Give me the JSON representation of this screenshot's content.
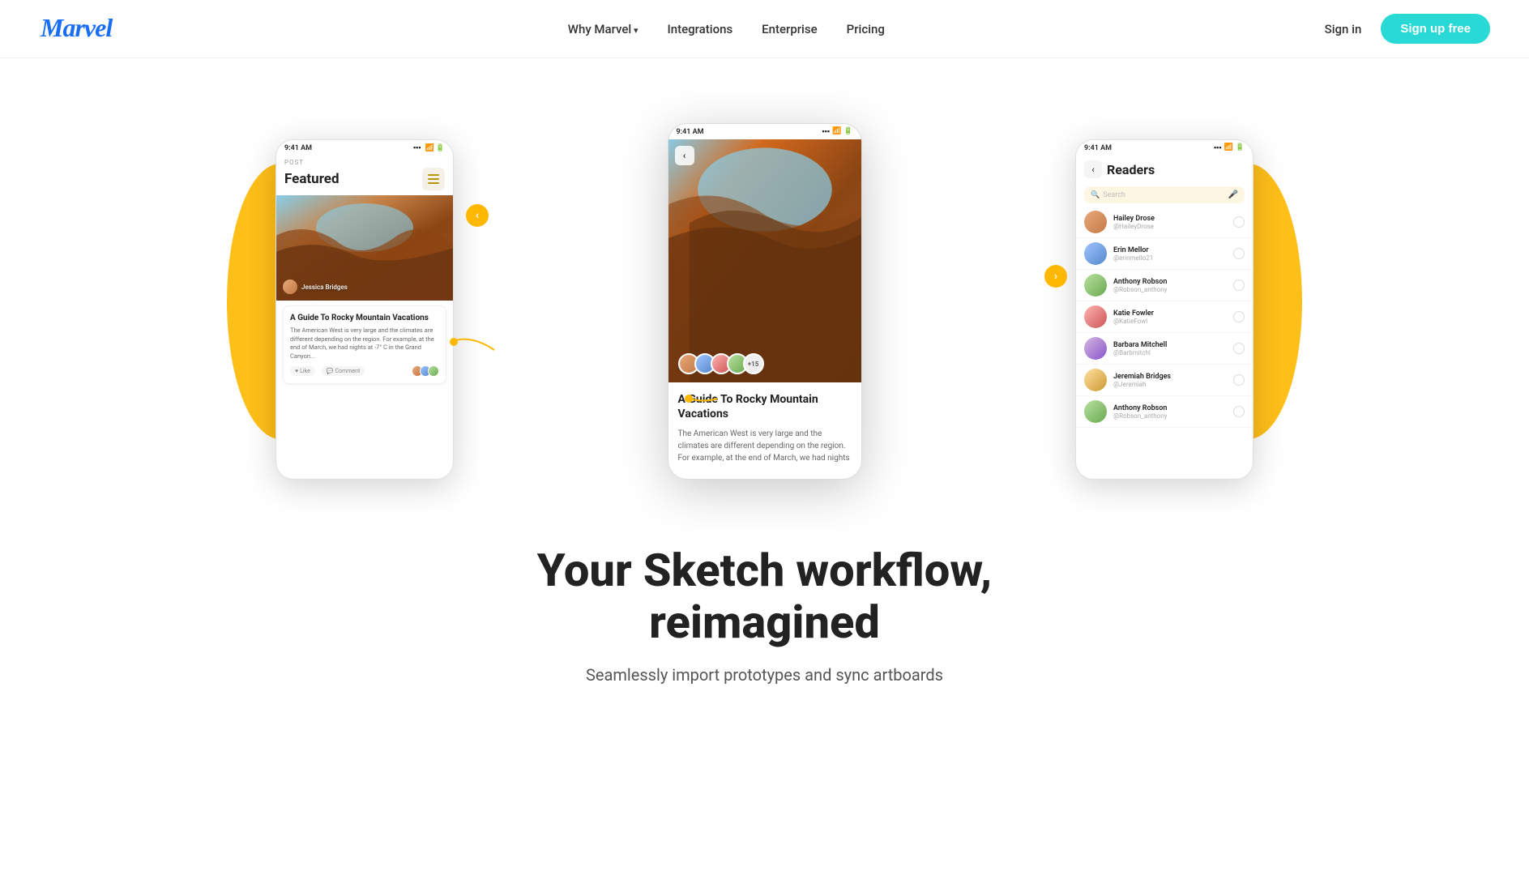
{
  "nav": {
    "logo": "Marvel",
    "links": [
      {
        "id": "why-marvel",
        "label": "Why Marvel",
        "hasArrow": true
      },
      {
        "id": "integrations",
        "label": "Integrations",
        "hasArrow": false
      },
      {
        "id": "enterprise",
        "label": "Enterprise",
        "hasArrow": false
      },
      {
        "id": "pricing",
        "label": "Pricing",
        "hasArrow": false
      }
    ],
    "signin": "Sign in",
    "signup": "Sign up free"
  },
  "phones": {
    "left": {
      "statusTime": "9:41 AM",
      "postLabel": "POST",
      "featuredTitle": "Featured",
      "articleTitle": "A Guide To Rocky Mountain Vacations",
      "articleBody": "The American West is very large and the climates are different depending on the region. For example, at the end of March, we had nights at -7° C in the Grand Canyon...",
      "author": "Jessica Bridges",
      "likeLabel": "Like",
      "commentLabel": "Comment"
    },
    "center": {
      "statusTime": "9:41 AM",
      "articleTitle": "A Guide To Rocky Mountain Vacations",
      "articleBody": "The American West is very large and the climates are different depending on the region. For example, at the end of March, we had nights",
      "moreCount": "+15"
    },
    "right": {
      "statusTime": "9:41 AM",
      "title": "Readers",
      "searchPlaceholder": "Search",
      "readers": [
        {
          "name": "Hailey Drose",
          "handle": "@HaileyDrose"
        },
        {
          "name": "Erin Mellor",
          "handle": "@erinmello21"
        },
        {
          "name": "Anthony Robson",
          "handle": "@Robson_anthony"
        },
        {
          "name": "Katie Fowler",
          "handle": "@KatieFowl"
        },
        {
          "name": "Barbara Mitchell",
          "handle": "@Barbmitchl"
        },
        {
          "name": "Jeremiah Bridges",
          "handle": "@Jeremiah"
        },
        {
          "name": "Anthony Robson",
          "handle": "@Robson_anthony"
        }
      ]
    }
  },
  "hero": {
    "heading": "Your Sketch workflow,\nreimagined",
    "subheading": "Seamlessly import prototypes and sync artboards"
  },
  "colors": {
    "accent": "#29d9d5",
    "yellow": "#ffb800",
    "dark": "#222",
    "text": "#555"
  }
}
